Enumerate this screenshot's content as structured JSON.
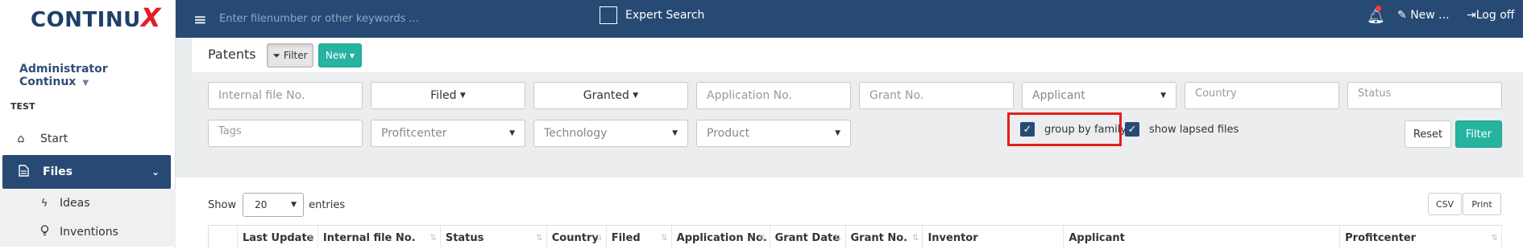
{
  "brand": {
    "logo_text": "CONTINU",
    "logo_x": "X"
  },
  "sidebar": {
    "user": "Administrator Continux",
    "section": "TEST",
    "items": [
      {
        "label": "Start",
        "icon": "home-icon"
      },
      {
        "label": "Files",
        "icon": "file-icon"
      }
    ],
    "subitems": [
      {
        "label": "Ideas",
        "icon": "bolt-icon"
      },
      {
        "label": "Inventions",
        "icon": "lightbulb-icon"
      }
    ]
  },
  "topbar": {
    "search_placeholder": "Enter filenumber or other keywords ...",
    "expert_search": "Expert Search",
    "new_label": "New ...",
    "logoff_label": "Log off"
  },
  "panel": {
    "title": "Patents",
    "filter_toggle": "Filter",
    "new_button": "New"
  },
  "filters": {
    "internal_file_no": "Internal file No.",
    "filed": "Filed",
    "granted": "Granted",
    "application_no": "Application No.",
    "grant_no": "Grant No.",
    "applicant": "Applicant",
    "country": "Country",
    "status": "Status",
    "tags": "Tags",
    "profitcenter": "Profitcenter",
    "technology": "Technology",
    "product": "Product",
    "group_by_family": "group by family",
    "show_lapsed": "show lapsed files",
    "group_by_family_checked": true,
    "show_lapsed_checked": true,
    "reset": "Reset",
    "apply": "Filter"
  },
  "table": {
    "show_label": "Show",
    "entries_value": "20",
    "entries_label": "entries",
    "csv": "CSV",
    "print": "Print",
    "columns": [
      "Last Update",
      "Internal file No.",
      "Status",
      "Country",
      "Filed",
      "Application No.",
      "Grant Date",
      "Grant No.",
      "Inventor",
      "Applicant",
      "Profitcenter"
    ]
  },
  "colors": {
    "primary": "#274a74",
    "accent": "#26b3a0",
    "highlight": "#e01f1f"
  }
}
